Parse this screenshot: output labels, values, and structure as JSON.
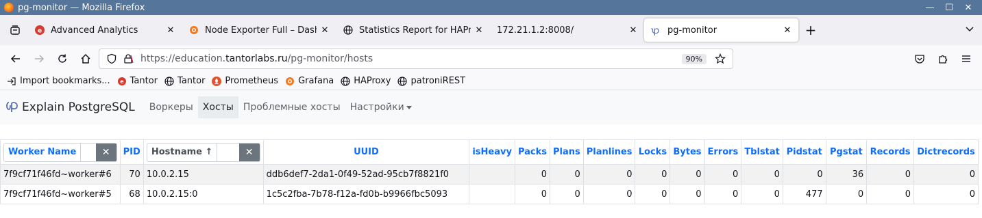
{
  "window": {
    "title": "pg-monitor — Mozilla Firefox",
    "controls": {
      "minimize": "—",
      "maximize": "☐",
      "close": "✕"
    }
  },
  "tabs": [
    {
      "label": "Advanced Analytics",
      "icon": "red-circle-icon",
      "active": false
    },
    {
      "label": "Node Exporter Full – Dashb",
      "icon": "grafana-icon",
      "active": false
    },
    {
      "label": "Statistics Report for HAPro",
      "icon": "globe-icon",
      "active": false
    },
    {
      "label": "172.21.1.2:8008/",
      "icon": "",
      "active": false
    },
    {
      "label": "pg-monitor",
      "icon": "pg-monitor-logo-icon",
      "active": true
    }
  ],
  "tab_close_glyph": "✕",
  "new_tab_glyph": "+",
  "url": {
    "prefix": "https://education.",
    "host": "tantorlabs.ru",
    "path": "/pg-monitor/hosts",
    "zoom": "90%"
  },
  "bookmarks": [
    {
      "label": "Import bookmarks...",
      "icon": "import-icon"
    },
    {
      "label": "Tantor",
      "icon": "tantor-icon"
    },
    {
      "label": "Tantor",
      "icon": "globe-icon"
    },
    {
      "label": "Prometheus",
      "icon": "prometheus-icon"
    },
    {
      "label": "Grafana",
      "icon": "grafana-icon"
    },
    {
      "label": "HAProxy",
      "icon": "globe-icon"
    },
    {
      "label": "patroniREST",
      "icon": "globe-icon"
    }
  ],
  "app": {
    "brand": "Explain PostgreSQL",
    "nav": [
      {
        "label": "Воркеры",
        "active": false
      },
      {
        "label": "Хосты",
        "active": true
      },
      {
        "label": "Проблемные хосты",
        "active": false
      },
      {
        "label": "Настройки",
        "active": false,
        "dropdown": true
      }
    ]
  },
  "table": {
    "filters": {
      "worker": {
        "label": "Worker Name",
        "clear": "✕"
      },
      "hostname": {
        "label": "Hostname ↑",
        "clear": "✕"
      }
    },
    "headers": [
      "PID",
      "UUID",
      "isHeavy",
      "Packs",
      "Plans",
      "Planlines",
      "Locks",
      "Bytes",
      "Errors",
      "Tblstat",
      "Pidstat",
      "Pgstat",
      "Records",
      "Dictrecords"
    ],
    "rows": [
      {
        "worker": "7f9cf71f46fd~worker#6",
        "pid": "70",
        "hostname": "10.0.2.15",
        "uuid": "ddb6def7-2da1-0f49-52ad-95cb7f8821f0",
        "isHeavy": "",
        "packs": "0",
        "plans": "0",
        "planlines": "0",
        "locks": "0",
        "bytes": "0",
        "errors": "0",
        "tblstat": "0",
        "pidstat": "0",
        "pgstat": "36",
        "records": "0",
        "dictrecords": "0"
      },
      {
        "worker": "7f9cf71f46fd~worker#5",
        "pid": "68",
        "hostname": "10.0.2.15:0",
        "uuid": "1c5c2fba-7b78-f12a-fd0b-b9966fbc5093",
        "isHeavy": "",
        "packs": "0",
        "plans": "0",
        "planlines": "0",
        "locks": "0",
        "bytes": "0",
        "errors": "0",
        "tblstat": "0",
        "pidstat": "477",
        "pgstat": "0",
        "records": "0",
        "dictrecords": "0"
      }
    ]
  }
}
